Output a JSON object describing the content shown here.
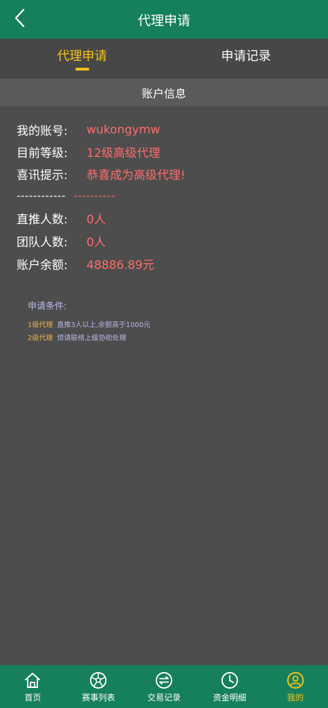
{
  "header": {
    "title": "代理申请"
  },
  "tabs": [
    {
      "label": "代理申请",
      "active": true
    },
    {
      "label": "申请记录",
      "active": false
    }
  ],
  "section": {
    "title": "账户信息"
  },
  "account": {
    "account_label": "我的账号:",
    "account_value": "wukongymw",
    "level_label": "目前等级:",
    "level_value": "12级高级代理",
    "notice_label": "喜讯提示:",
    "notice_value": "恭喜成为高级代理!",
    "divider_left": "------------",
    "divider_right": "----------",
    "direct_label": "直推人数:",
    "direct_value": "0人",
    "team_label": "团队人数:",
    "team_value": "0人",
    "balance_label": "账户余额:",
    "balance_value": "48886.89元"
  },
  "conditions": {
    "title": "申请条件:",
    "items": [
      {
        "level": "1级代理",
        "desc": "直推3人以上,余额高于1000元"
      },
      {
        "level": "2级代理",
        "desc": "烦请联络上级协助处理"
      }
    ]
  },
  "bottom_nav": [
    {
      "label": "首页",
      "icon": "home-icon",
      "active": false
    },
    {
      "label": "赛事列表",
      "icon": "soccer-ball-icon",
      "active": false
    },
    {
      "label": "交易记录",
      "icon": "exchange-icon",
      "active": false
    },
    {
      "label": "资金明细",
      "icon": "clock-icon",
      "active": false
    },
    {
      "label": "我的",
      "icon": "user-icon",
      "active": true
    }
  ],
  "colors": {
    "header_bg": "#16805c",
    "accent": "#f5c518",
    "value_red": "#ff6b6b",
    "page_bg": "#4d4d4d"
  }
}
